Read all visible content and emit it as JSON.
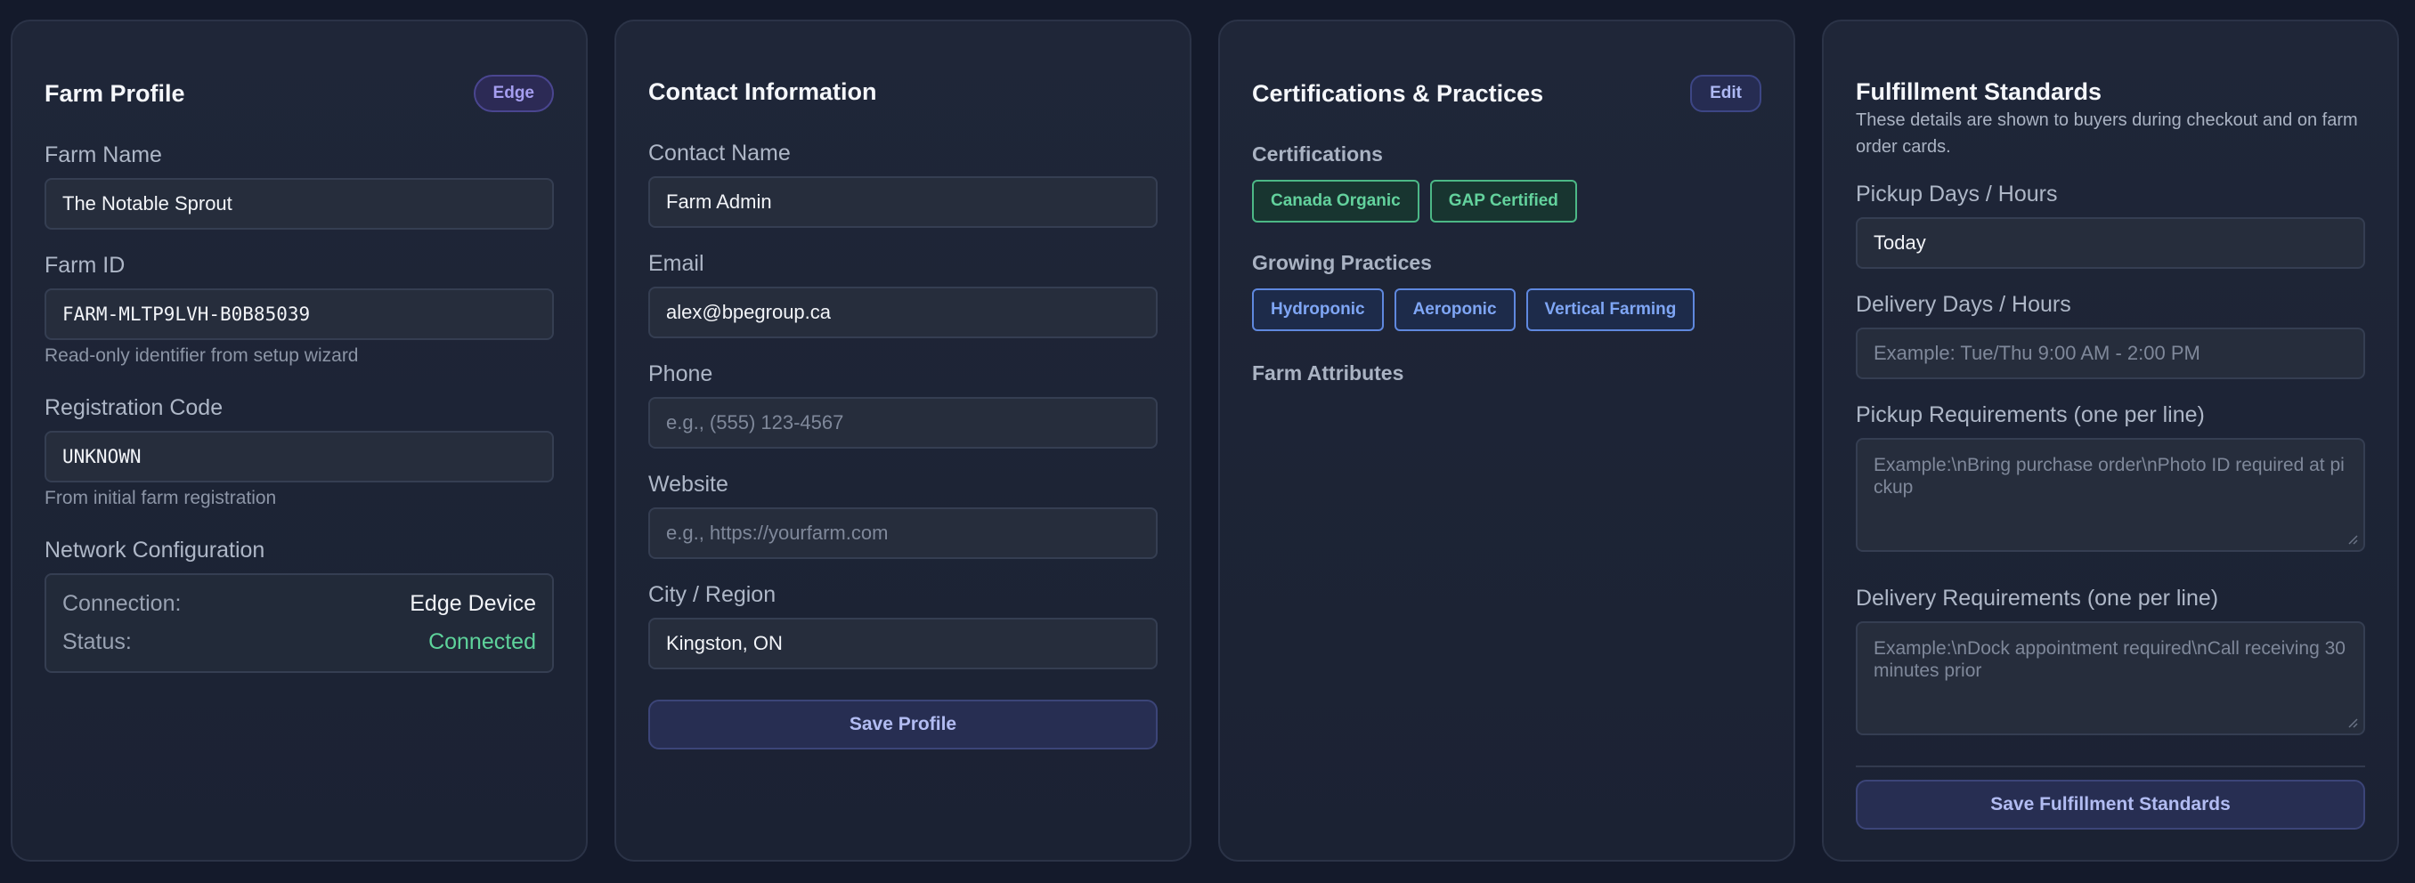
{
  "farm_profile": {
    "title": "Farm Profile",
    "badge": "Edge",
    "farm_name_label": "Farm Name",
    "farm_name_value": "The Notable Sprout",
    "farm_id_label": "Farm ID",
    "farm_id_value": "FARM-MLTP9LVH-B0B85039",
    "farm_id_helper": "Read-only identifier from setup wizard",
    "reg_code_label": "Registration Code",
    "reg_code_value": "UNKNOWN",
    "reg_code_helper": "From initial farm registration",
    "network_label": "Network Configuration",
    "connection_key": "Connection:",
    "connection_value": "Edge Device",
    "status_key": "Status:",
    "status_value": "Connected"
  },
  "contact": {
    "title": "Contact Information",
    "contact_name_label": "Contact Name",
    "contact_name_value": "Farm Admin",
    "email_label": "Email",
    "email_value": "alex@bpegroup.ca",
    "phone_label": "Phone",
    "phone_placeholder": "e.g., (555) 123-4567",
    "website_label": "Website",
    "website_placeholder": "e.g., https://yourfarm.com",
    "city_label": "City / Region",
    "city_value": "Kingston, ON",
    "save_label": "Save Profile"
  },
  "certifications": {
    "title": "Certifications & Practices",
    "edit_label": "Edit",
    "certs_label": "Certifications",
    "certs": [
      "Canada Organic",
      "GAP Certified"
    ],
    "practices_label": "Growing Practices",
    "practices": [
      "Hydroponic",
      "Aeroponic",
      "Vertical Farming"
    ],
    "attributes_label": "Farm Attributes"
  },
  "fulfillment": {
    "title": "Fulfillment Standards",
    "description": "These details are shown to buyers during checkout and on farm order cards.",
    "pickup_label": "Pickup Days / Hours",
    "pickup_value": "Today",
    "delivery_label": "Delivery Days / Hours",
    "delivery_placeholder": "Example: Tue/Thu 9:00 AM - 2:00 PM",
    "pickup_req_label": "Pickup Requirements (one per line)",
    "pickup_req_placeholder": "Example:\\nBring purchase order\\nPhoto ID required at pickup",
    "delivery_req_label": "Delivery Requirements (one per line)",
    "delivery_req_placeholder": "Example:\\nDock appointment required\\nCall receiving 30 minutes prior",
    "save_label": "Save Fulfillment Standards"
  },
  "colors": {
    "background": "#141a2b",
    "card": "#1f2638",
    "accent": "#b2bcf2",
    "success": "#5ed39b",
    "cert_green": "#63d29d",
    "practice_blue": "#7fa6f5"
  }
}
